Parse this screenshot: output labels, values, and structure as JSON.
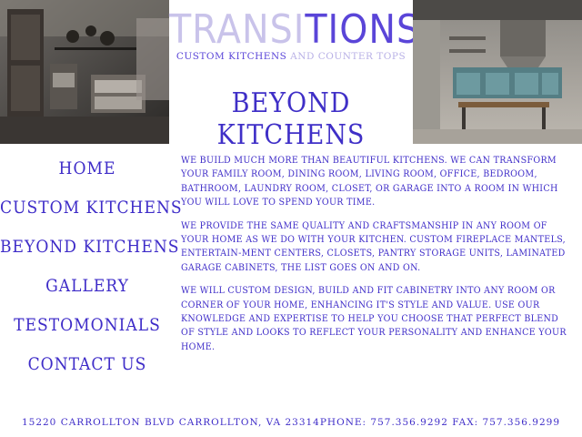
{
  "logo": {
    "title_a": "TRANSI",
    "title_b": "TIONS",
    "subtitle_a": "CUSTOM KITCHENS",
    "subtitle_b": " AND COUNTER TOPS"
  },
  "page_heading": "BEYOND KITCHENS",
  "nav": {
    "items": [
      {
        "label": "HOME"
      },
      {
        "label": "CUSTOM KITCHENS"
      },
      {
        "label": "BEYOND KITCHENS"
      },
      {
        "label": "GALLERY"
      },
      {
        "label": "TESTOMONIALS"
      },
      {
        "label": "CONTACT US"
      }
    ]
  },
  "content": {
    "paragraphs": [
      "WE BUILD MUCH MORE THAN BEAUTIFUL KITCHENS. WE CAN TRANSFORM YOUR FAMILY ROOM, DINING ROOM, LIVING ROOM, OFFICE, BEDROOM, BATHROOM, LAUNDRY ROOM, CLOSET, OR GARAGE INTO A ROOM IN WHICH YOU WILL LOVE TO SPEND YOUR TIME.",
      "WE PROVIDE THE SAME QUALITY AND CRAFTSMANSHIP IN ANY ROOM OF YOUR HOME AS WE DO WITH YOUR KITCHEN. CUSTOM FIREPLACE MANTELS, ENTERTAIN-MENT CENTERS, CLOSETS, PANTRY STORAGE UNITS, LAMINATED GARAGE CABINETS, THE LIST GOES ON AND ON.",
      "WE WILL CUSTOM DESIGN, BUILD AND FIT CABINETRY INTO ANY ROOM OR CORNER OF YOUR HOME, ENHANCING IT'S STYLE AND VALUE. USE OUR KNOWLEDGE AND EXPERTISE TO HELP YOU CHOOSE THAT PERFECT BLEND OF STYLE AND LOOKS TO REFLECT YOUR PERSONALITY AND ENHANCE YOUR HOME."
    ]
  },
  "footer": {
    "text": "15220 CARROLLTON BLVD CARROLLTON, VA 23314PHONE: 757.356.9292 FAX: 757.356.9299"
  },
  "colors": {
    "brand": "#3e2cc8",
    "brand_light": "#c9c3ea",
    "background": "#ffffff"
  }
}
